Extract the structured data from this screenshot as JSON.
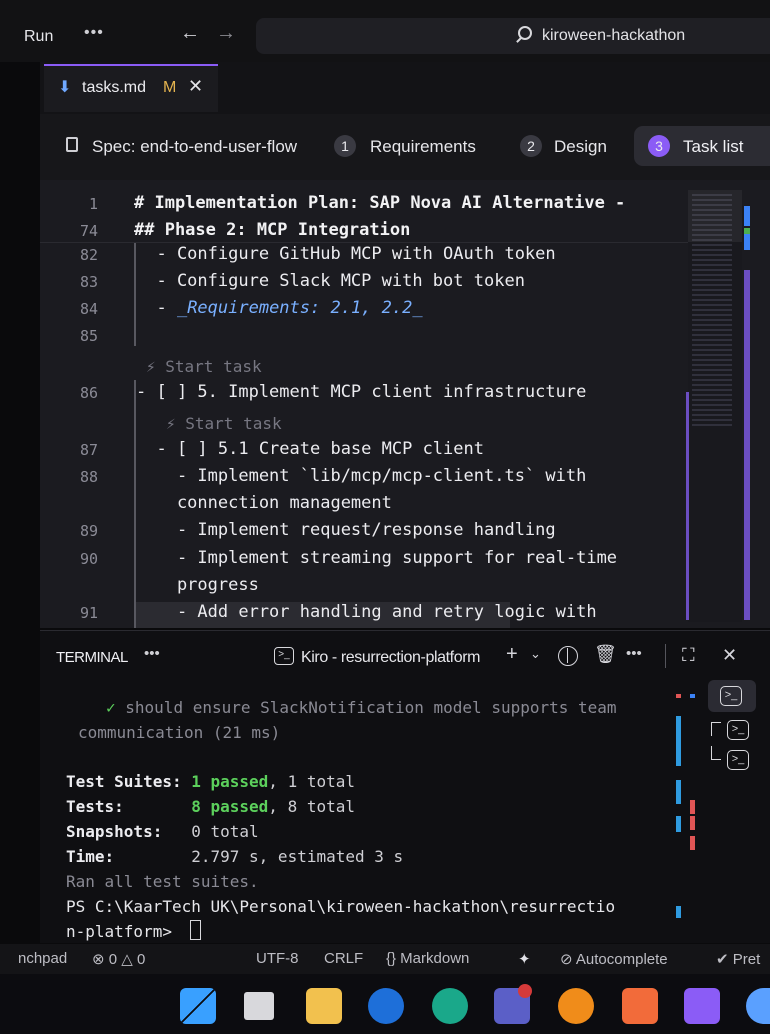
{
  "titlebar": {
    "run": "Run",
    "more": "•••",
    "back": "←",
    "forward": "→",
    "search": "kiroween-hackathon"
  },
  "tab": {
    "label": "tasks.md",
    "modified": "M",
    "close": "✕",
    "icon": "markdown-file-icon"
  },
  "spec": {
    "label": "Spec: end-to-end-user-flow",
    "steps": [
      {
        "num": "1",
        "label": "Requirements"
      },
      {
        "num": "2",
        "label": "Design"
      },
      {
        "num": "3",
        "label": "Task list"
      }
    ]
  },
  "editor": {
    "sticky": [
      {
        "ln": "1",
        "text": "# Implementation Plan: SAP Nova AI Alternative -"
      },
      {
        "ln": "74",
        "text": "## Phase 2: MCP Integration"
      }
    ],
    "lines": [
      {
        "ln": "82",
        "text": "  - Configure GitHub MCP with OAuth token"
      },
      {
        "ln": "83",
        "text": "  - Configure Slack MCP with bot token"
      },
      {
        "ln": "84",
        "prefix": "  - ",
        "req": "_Requirements: 2.1, 2.2_"
      },
      {
        "ln": "85",
        "text": ""
      },
      {
        "codelens": "⚡ Start task"
      },
      {
        "ln": "86",
        "text": "- [ ] 5. Implement MCP client infrastructure"
      },
      {
        "codelens": "⚡ Start task"
      },
      {
        "ln": "87",
        "text": "  - [ ] 5.1 Create base MCP client"
      },
      {
        "ln": "88",
        "text": "    - Implement `lib/mcp/mcp-client.ts` with"
      },
      {
        "text": "    connection management"
      },
      {
        "ln": "89",
        "text": "    - Implement request/response handling"
      },
      {
        "ln": "90",
        "text": "    - Implement streaming support for real-time"
      },
      {
        "text": "    progress"
      },
      {
        "ln": "91",
        "text": "    - Add error handling and retry logic with"
      }
    ]
  },
  "terminal": {
    "title": "TERMINAL",
    "more": "•••",
    "name": "Kiro - resurrection-platform",
    "lines": {
      "l1_check": "✓",
      "l1_text": " should ensure SlackNotification model supports team",
      "l2": "communication (21 ms)",
      "suites_label": "Test Suites: ",
      "suites_passed": "1 passed",
      "suites_rest": ", 1 total",
      "tests_label": "Tests:       ",
      "tests_passed": "8 passed",
      "tests_rest": ", 8 total",
      "snap_label": "Snapshots:   ",
      "snap_rest": "0 total",
      "time_label": "Time:        ",
      "time_rest": "2.797 s, estimated 3 s",
      "ran": "Ran all test suites.",
      "ps1": "PS C:\\KaarTech UK\\Personal\\kiroween-hackathon\\resurrectio",
      "ps2": "n-platform> "
    }
  },
  "statusbar": {
    "workspace": "nchpad",
    "problems": "⊗ 0 △ 0",
    "encoding": "UTF-8",
    "eol": "CRLF",
    "language": "{} Markdown",
    "sparkle": "✦",
    "autocomplete": "⊘ Autocomplete",
    "prettier": "✔ Pret"
  },
  "colors": {
    "accent": "#8b5cf6",
    "pass": "#5cd05c",
    "link": "#7ab0ff",
    "modified": "#e3b34f"
  }
}
